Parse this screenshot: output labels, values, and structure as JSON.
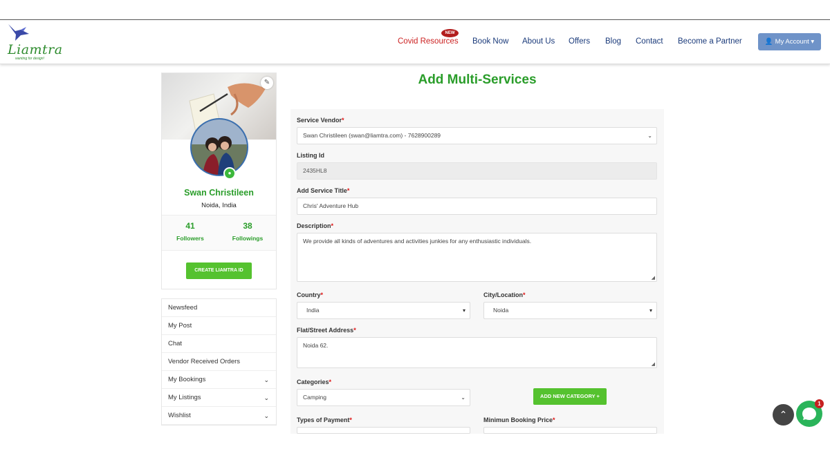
{
  "brand": {
    "logo_text": "Liamtra",
    "tagline": "wanting for design!"
  },
  "nav": {
    "covid": "Covid Resources",
    "new_badge": "NEW",
    "book": "Book Now",
    "about": "About Us",
    "offers": "Offers",
    "blog": "Blog",
    "contact": "Contact",
    "partner": "Become a Partner",
    "account": "My Account"
  },
  "profile": {
    "name": "Swan Christileen",
    "location": "Noida, India",
    "followers_count": "41",
    "followers_label": "Followers",
    "followings_count": "38",
    "followings_label": "Followings",
    "create_id_label": "CREATE LIAMTRA ID"
  },
  "menu": [
    {
      "label": "Newsfeed"
    },
    {
      "label": "My Post"
    },
    {
      "label": "Chat"
    },
    {
      "label": "Vendor Received Orders"
    },
    {
      "label": "My Bookings"
    },
    {
      "label": "My Listings"
    },
    {
      "label": "Wishlist"
    }
  ],
  "form": {
    "title": "Add Multi-Services",
    "service_vendor_label": "Service Vendor",
    "service_vendor_value": "Swan Christileen (swan@liamtra.com) - 7628900289",
    "listing_id_label": "Listing Id",
    "listing_id_value": "2435HL8",
    "service_title_label": "Add Service Title",
    "service_title_value": "Chris' Adventure Hub",
    "description_label": "Description",
    "description_value": "We provide all kinds of adventures and activities junkies for any enthusiastic individuals.",
    "country_label": "Country",
    "country_value": "India",
    "city_label": "City/Location",
    "city_value": "Noida",
    "address_label": "Flat/Street Address",
    "address_value": "Noida 62.",
    "categories_label": "Categories",
    "categories_value": "Camping",
    "add_category_label": "ADD NEW CATEGORY +",
    "payment_label": "Types of Payment",
    "min_price_label": "Minimun Booking Price",
    "required_mark": "*"
  },
  "widgets": {
    "chat_badge": "1"
  },
  "colors": {
    "brand_green": "#2a9d2a",
    "button_green": "#55c22f",
    "nav_blue": "#1a3a7a",
    "covid_red": "#cc2222",
    "account_blue": "#6f93c8"
  }
}
